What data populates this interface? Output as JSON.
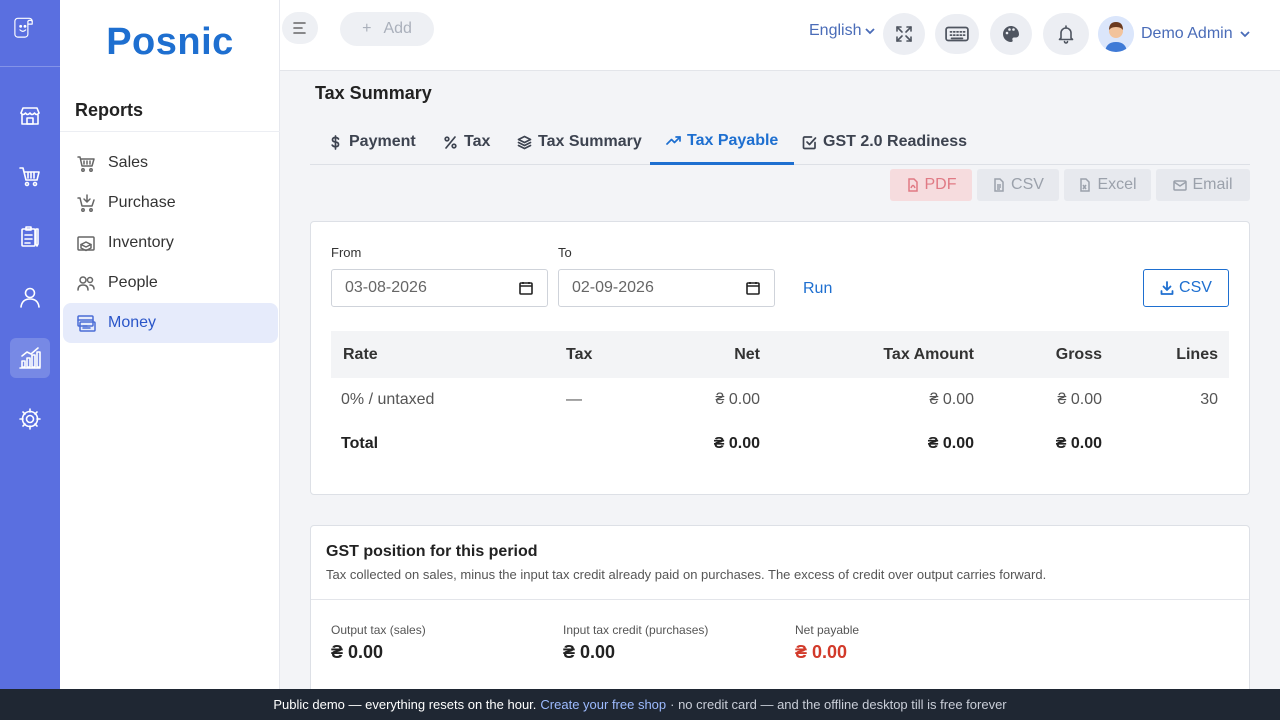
{
  "app": {
    "brand": "Posnic"
  },
  "rail": {
    "items": [
      "store-icon",
      "cart-icon",
      "clipboard-icon",
      "user-icon",
      "chart-icon",
      "gear-icon"
    ],
    "active": "chart-icon"
  },
  "sidebar": {
    "title": "Reports",
    "items": [
      {
        "label": "Sales",
        "icon": "basket-icon"
      },
      {
        "label": "Purchase",
        "icon": "cart-download-icon"
      },
      {
        "label": "Inventory",
        "icon": "box-icon"
      },
      {
        "label": "People",
        "icon": "people-icon"
      },
      {
        "label": "Money",
        "icon": "money-icon",
        "active": true
      }
    ]
  },
  "topbar": {
    "add_label": "Add",
    "language": "English",
    "user_name": "Demo Admin"
  },
  "page": {
    "title": "Tax Summary",
    "tabs": [
      {
        "label": "Payment",
        "icon": "dollar-icon"
      },
      {
        "label": "Tax",
        "icon": "percent-icon"
      },
      {
        "label": "Tax Summary",
        "icon": "layers-icon"
      },
      {
        "label": "Tax Payable",
        "icon": "trend-up-icon",
        "active": true
      },
      {
        "label": "GST 2.0 Readiness",
        "icon": "checkbox-icon"
      }
    ],
    "export": {
      "pdf": "PDF",
      "csv": "CSV",
      "excel": "Excel",
      "email": "Email"
    }
  },
  "filters": {
    "from_label": "From",
    "from_value": "03-08-2026",
    "to_label": "To",
    "to_value": "02-09-2026",
    "run_label": "Run",
    "csv_label": "CSV"
  },
  "table": {
    "headers": [
      "Rate",
      "Tax",
      "Net",
      "Tax Amount",
      "Gross",
      "Lines"
    ],
    "rows": [
      [
        "0% / untaxed",
        "—",
        "₴ 0.00",
        "₴ 0.00",
        "₴ 0.00",
        "30"
      ]
    ],
    "total": [
      "Total",
      "",
      "₴ 0.00",
      "₴ 0.00",
      "₴ 0.00",
      ""
    ]
  },
  "gst": {
    "title": "GST position for this period",
    "description": "Tax collected on sales, minus the input tax credit already paid on purchases. The excess of credit over output carries forward.",
    "output_label": "Output tax (sales)",
    "output_value": "₴ 0.00",
    "input_label": "Input tax credit (purchases)",
    "input_value": "₴ 0.00",
    "net_label": "Net payable",
    "net_value": "₴ 0.00",
    "net_color": "#d23a2a"
  },
  "footer": {
    "text": "Public demo — everything resets on the hour.",
    "link": "Create your free shop",
    "tail": "· no credit card — and the offline desktop till is free forever"
  },
  "colors": {
    "rail": "#5a6fe0",
    "accent": "#1e6fd0",
    "footer": "#1f2733"
  }
}
